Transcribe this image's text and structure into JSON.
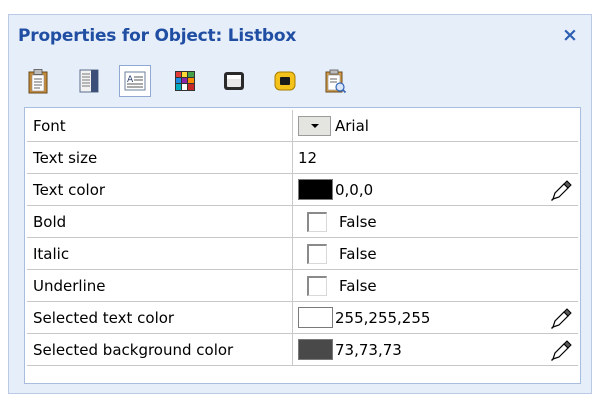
{
  "window": {
    "title": "Properties for Object: Listbox",
    "close_glyph": "×"
  },
  "toolbar": {
    "buttons": [
      {
        "icon": "clipboard-icon",
        "active": false
      },
      {
        "icon": "document-lines-icon",
        "active": false
      },
      {
        "icon": "text-format-icon",
        "active": true
      },
      {
        "icon": "color-grid-icon",
        "active": false
      },
      {
        "icon": "border-frame-icon",
        "active": false
      },
      {
        "icon": "button-shape-icon",
        "active": false
      },
      {
        "icon": "clipboard-check-icon",
        "active": false
      }
    ]
  },
  "properties": [
    {
      "name": "Font",
      "value": "Arial",
      "type": "dropdown"
    },
    {
      "name": "Text size",
      "value": "12",
      "type": "text"
    },
    {
      "name": "Text color",
      "value": "0,0,0",
      "type": "color",
      "swatch": "#000000"
    },
    {
      "name": "Bold",
      "value": "False",
      "type": "checkbox"
    },
    {
      "name": "Italic",
      "value": "False",
      "type": "checkbox"
    },
    {
      "name": "Underline",
      "value": "False",
      "type": "checkbox"
    },
    {
      "name": "Selected text color",
      "value": "255,255,255",
      "type": "color",
      "swatch": "#ffffff"
    },
    {
      "name": "Selected background color",
      "value": "73,73,73",
      "type": "color",
      "swatch": "#494949"
    }
  ],
  "colors": {
    "title_text": "#1f4ea2",
    "panel_background": "#e6eefa",
    "active_tab_border": "#8fa9d2"
  }
}
